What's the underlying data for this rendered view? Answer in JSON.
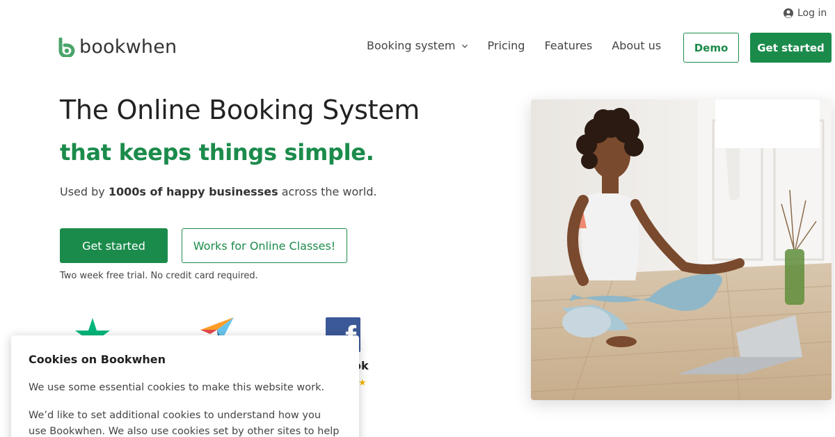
{
  "header": {
    "login_label": "Log in",
    "logo_text": "bookwhen",
    "nav": [
      "Booking system",
      "Pricing",
      "Features",
      "About us"
    ],
    "demo_label": "Demo",
    "get_started_label": "Get started"
  },
  "hero": {
    "title": "The Online Booking System",
    "subtitle": "that keeps things simple.",
    "used_prefix": "Used by ",
    "used_bold": "1000s of happy businesses",
    "used_suffix": " across the world.",
    "primary_cta": "Get started",
    "secondary_cta": "Works for Online Classes!",
    "trial_note": "Two week free trial. No credit card required."
  },
  "reviews": {
    "facebook_text_visible": "ok",
    "facebook_star": "★"
  },
  "cookie_banner": {
    "title": "Cookies on Bookwhen",
    "p1": "We use some essential cookies to make this website work.",
    "p2": "We’d like to set additional cookies to understand how you use Bookwhen. We also use cookies set by other sites to help us"
  },
  "colors": {
    "brand_green": "#1b8b4b",
    "facebook_blue": "#3b5998",
    "trustpilot_green": "#00b67a",
    "star_yellow": "#f5b400"
  },
  "icons": [
    "user-circle-icon",
    "chevron-down-icon",
    "bookwhen-logo-icon",
    "trustpilot-star-icon",
    "capterra-logo-icon",
    "facebook-logo-icon"
  ]
}
